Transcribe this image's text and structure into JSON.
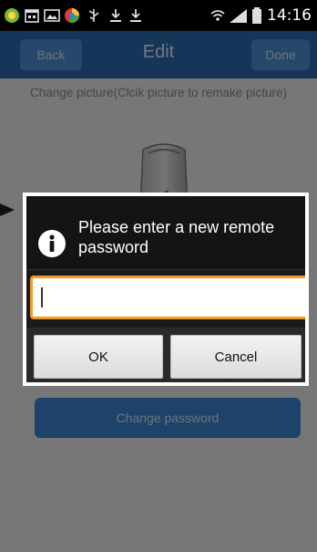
{
  "status_bar": {
    "time": "14:16",
    "icons": [
      "app-icon",
      "calendar-icon",
      "image-icon",
      "browser-icon",
      "usb-icon",
      "download-icon",
      "download-icon",
      "wifi-icon",
      "signal-icon",
      "battery-icon"
    ]
  },
  "header": {
    "back_label": "Back",
    "title": "Edit",
    "done_label": "Done"
  },
  "hint": "Change picture(Clcik picture to remake picture)",
  "change_password_label": "Change password",
  "dialog": {
    "title": "Please enter a new remote password",
    "input_value": "",
    "ok_label": "OK",
    "cancel_label": "Cancel"
  },
  "colors": {
    "header": "#2b6cb0",
    "header_button": "#4f90d4",
    "primary_button": "#3a86d4",
    "input_focus": "#f39c23"
  }
}
